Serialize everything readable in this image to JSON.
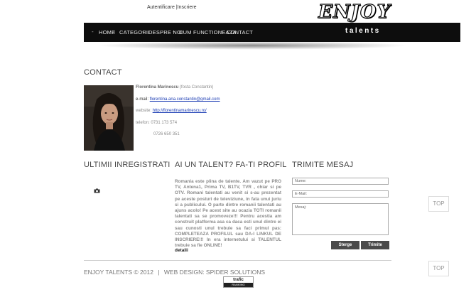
{
  "header": {
    "auth_login": "Autentificare",
    "auth_sep": "|",
    "auth_register": "Inscriere",
    "logo_main": "ENJOY",
    "logo_sub": "talents"
  },
  "nav": {
    "items": [
      "HOME",
      "CATEGORII",
      "DESPRE NOI",
      "CUM FUNCTIONEAZA",
      "CONTACT"
    ]
  },
  "contact": {
    "heading": "CONTACT",
    "name": "Florentina Marinescu",
    "name_note": "(fosta Constantin)",
    "email_label": "e-mail:",
    "email_value": "florentina.ana.constantin@gmail.com",
    "website_label": "website:",
    "website_value": "http://florentinamarinescu.ro/",
    "phone_label": "telefon:",
    "phone_1": "0731 173 574",
    "phone_2": "0726 650 351"
  },
  "sections": {
    "latest": "ULTIMII INREGISTRATI",
    "talent": "AI UN TALENT? FA-TI PROFIL",
    "message": "TRIMITE MESAJ"
  },
  "talent_text": "Romania este plina de talente. Am vazut pe PRO TV, Antena1, Prima TV, B1TV, TVR , chiar si pe OTV. Romani talentati au venit si s-au prezentat pe aceste posturi de televiziune, in fata unui juriu si a publicului. O parte dintre romanii talentati au ajuns acolo! Pe acest site au ocazia TOTI romanii talentati sa se promoveze!!! Pentru acestia am construit platforma asa ca daca esti unul dintre ei sau cunosti unul trebuie sa faci primul pas: COMPLETEAZA PROFILUL sau DA-I LINKUL DE INSCRIERE!!! In era internetului si TALENTUL trebuie sa fie ONLINE!",
  "talent_more": "detalii",
  "form": {
    "name_placeholder": "Nume:",
    "email_placeholder": "E-Mail:",
    "message_placeholder": "Mesaj:",
    "clear_label": "Sterge",
    "send_label": "Trimite"
  },
  "top_label": "TOP",
  "footer": {
    "copyright": "ENJOY TALENTS © 2012",
    "sep": "|",
    "design": "WEB DESIGN: SPIDER SOLUTIONS",
    "badge_top": "trafic",
    "badge_bottom": "RANKING"
  },
  "colors": {
    "navbar": "#0d0d0d",
    "link": "#1a3bb3",
    "button": "#4a4a4a"
  }
}
